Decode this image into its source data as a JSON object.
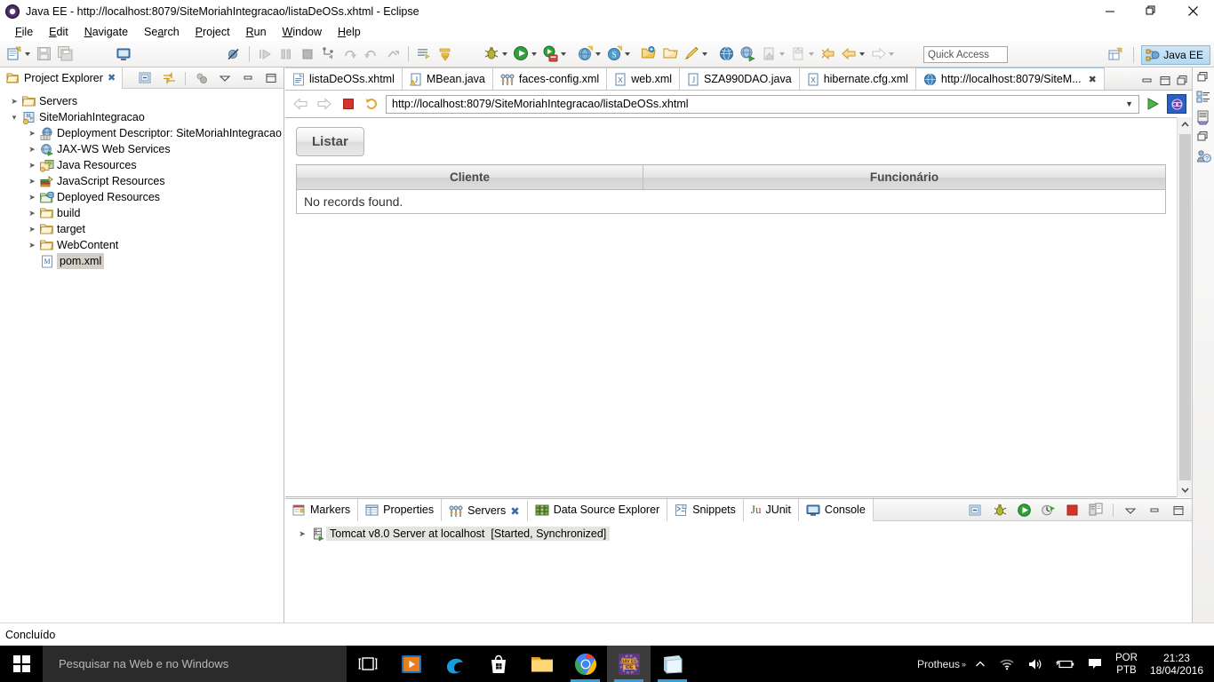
{
  "window": {
    "title": "Java EE - http://localhost:8079/SiteMoriahIntegracao/listaDeOSs.xhtml - Eclipse",
    "app_icon": "eclipse-icon",
    "minimize_label": "—",
    "maximize_label": "❐",
    "close_label": "✕"
  },
  "menubar": {
    "items": [
      {
        "label": "File",
        "mnemonic": "F"
      },
      {
        "label": "Edit",
        "mnemonic": "E"
      },
      {
        "label": "Navigate",
        "mnemonic": "N"
      },
      {
        "label": "Search",
        "mnemonic": "a"
      },
      {
        "label": "Project",
        "mnemonic": "P"
      },
      {
        "label": "Run",
        "mnemonic": "R"
      },
      {
        "label": "Window",
        "mnemonic": "W"
      },
      {
        "label": "Help",
        "mnemonic": "H"
      }
    ]
  },
  "toolbar": {
    "quick_access_placeholder": "Quick Access",
    "perspective_label": "Java EE",
    "items": [
      "new-wizard-icon",
      "save-icon",
      "save-all-icon",
      "console-view-icon",
      "toggle-breakpoint-icon",
      "resume-icon",
      "suspend-icon",
      "terminate-icon",
      "step-into-icon",
      "step-over-icon",
      "step-return-icon",
      "step-filters-icon",
      "run-last-tool-icon",
      "debug-icon",
      "run-icon",
      "run-server-icon",
      "new-java-ee-icon",
      "search-icon",
      "open-type-icon",
      "open-resource-icon",
      "annotation-icon",
      "web-browser-icon",
      "web-service-icon",
      "previous-edit-icon",
      "next-edit-icon",
      "back-icon",
      "forward-icon"
    ]
  },
  "project_explorer": {
    "tab_label": "Project Explorer",
    "tab_icon": "project-explorer-icon",
    "tools": [
      "collapse-all-icon",
      "link-with-editor-icon",
      "focus-on-active-task-icon",
      "view-menu-icon",
      "minimize-icon",
      "maximize-icon"
    ],
    "tree": [
      {
        "label": "Servers",
        "icon": "folder-icon",
        "depth": 0,
        "expandable": true,
        "expanded": false,
        "selected": false
      },
      {
        "label": "SiteMoriahIntegracao",
        "icon": "maven-project-icon",
        "depth": 0,
        "expandable": true,
        "expanded": true,
        "selected": false
      },
      {
        "label": "Deployment Descriptor: SiteMoriahIntegracao",
        "icon": "deployment-descriptor-icon",
        "depth": 1,
        "expandable": true,
        "expanded": false,
        "selected": false
      },
      {
        "label": "JAX-WS Web Services",
        "icon": "web-service-icon",
        "depth": 1,
        "expandable": true,
        "expanded": false,
        "selected": false
      },
      {
        "label": "Java Resources",
        "icon": "java-resources-icon",
        "depth": 1,
        "expandable": true,
        "expanded": false,
        "selected": false
      },
      {
        "label": "JavaScript Resources",
        "icon": "javascript-resources-icon",
        "depth": 1,
        "expandable": true,
        "expanded": false,
        "selected": false
      },
      {
        "label": "Deployed Resources",
        "icon": "deployed-resources-icon",
        "depth": 1,
        "expandable": true,
        "expanded": false,
        "selected": false
      },
      {
        "label": "build",
        "icon": "folder-icon",
        "depth": 1,
        "expandable": true,
        "expanded": false,
        "selected": false
      },
      {
        "label": "target",
        "icon": "folder-icon",
        "depth": 1,
        "expandable": true,
        "expanded": false,
        "selected": false
      },
      {
        "label": "WebContent",
        "icon": "folder-icon",
        "depth": 1,
        "expandable": true,
        "expanded": false,
        "selected": false
      },
      {
        "label": "pom.xml",
        "icon": "maven-pom-icon",
        "depth": 1,
        "expandable": false,
        "expanded": false,
        "selected": true
      }
    ]
  },
  "editor": {
    "tabs": [
      {
        "label": "listaDeOSs.xhtml",
        "icon": "xhtml-file-icon",
        "active": false,
        "closable": false
      },
      {
        "label": "MBean.java",
        "icon": "java-warning-file-icon",
        "active": false,
        "closable": false
      },
      {
        "label": "faces-config.xml",
        "icon": "faces-config-icon",
        "active": false,
        "closable": false
      },
      {
        "label": "web.xml",
        "icon": "xml-file-icon",
        "active": false,
        "closable": false
      },
      {
        "label": "SZA990DAO.java",
        "icon": "java-file-icon",
        "active": false,
        "closable": false
      },
      {
        "label": "hibernate.cfg.xml",
        "icon": "xml-file-icon",
        "active": false,
        "closable": false
      },
      {
        "label": "http://localhost:8079/SiteM...",
        "icon": "web-browser-icon",
        "active": true,
        "closable": true
      }
    ],
    "tab_tools": [
      "minimize-icon",
      "maximize-icon",
      "restore-icon"
    ],
    "browser": {
      "back_icon": "back-arrow-icon",
      "forward_icon": "forward-arrow-icon",
      "stop_icon": "stop-icon",
      "refresh_icon": "refresh-icon",
      "url": "http://localhost:8079/SiteMoriahIntegracao/listaDeOSs.xhtml",
      "dropdown_icon": "chevron-down-icon",
      "go_icon": "go-play-icon",
      "open_external_icon": "open-external-browser-icon",
      "scroll_up_icon": "▲",
      "scroll_down_icon": "▼"
    },
    "page": {
      "button_label": "Listar",
      "table": {
        "headers": [
          "Cliente",
          "Funcionário"
        ],
        "empty_message": "No records found."
      }
    }
  },
  "right_rail": {
    "items": [
      "restore-view-icon",
      "outline-view-icon",
      "properties-view-icon",
      "snippets-view-icon",
      "help-view-icon"
    ]
  },
  "bottom_panel": {
    "tabs": [
      {
        "label": "Markers",
        "icon": "markers-icon",
        "active": false,
        "closable": false
      },
      {
        "label": "Properties",
        "icon": "properties-icon",
        "active": false,
        "closable": false
      },
      {
        "label": "Servers",
        "icon": "servers-icon",
        "active": true,
        "closable": true
      },
      {
        "label": "Data Source Explorer",
        "icon": "data-source-explorer-icon",
        "active": false,
        "closable": false
      },
      {
        "label": "Snippets",
        "icon": "snippets-icon",
        "active": false,
        "closable": false
      },
      {
        "label": "JUnit",
        "icon": "junit-icon",
        "active": false,
        "closable": false
      },
      {
        "label": "Console",
        "icon": "console-icon",
        "active": false,
        "closable": false
      }
    ],
    "tools": [
      "collapse-all-icon",
      "debug-server-icon",
      "start-server-icon",
      "profile-server-icon",
      "stop-server-icon",
      "publish-icon",
      "view-menu-icon",
      "minimize-icon",
      "maximize-icon"
    ],
    "servers": [
      {
        "name": "Tomcat v8.0 Server at localhost",
        "state": "[Started, Synchronized]",
        "icon": "tomcat-server-icon"
      }
    ]
  },
  "statusbar": {
    "message": "Concluído"
  },
  "taskbar": {
    "start_icon": "windows-start-icon",
    "search_placeholder": "Pesquisar na Web e no Windows",
    "task_view_icon": "task-view-icon",
    "apps": [
      {
        "name": "media-player-icon",
        "running": false,
        "active": false
      },
      {
        "name": "microsoft-edge-icon",
        "running": false,
        "active": false
      },
      {
        "name": "microsoft-store-icon",
        "running": false,
        "active": false
      },
      {
        "name": "file-explorer-icon",
        "running": false,
        "active": false
      },
      {
        "name": "google-chrome-icon",
        "running": true,
        "active": false
      },
      {
        "name": "eclipse-ide-icon",
        "running": true,
        "active": true
      },
      {
        "name": "notepad-icon",
        "running": true,
        "active": false
      }
    ],
    "tray": {
      "app_label": "Protheus",
      "overflow_icon": "chevron-up-icon",
      "network_icon": "wifi-icon",
      "volume_icon": "speaker-icon",
      "power_icon": "battery-icon",
      "action_center_icon": "action-center-icon",
      "language_line1": "POR",
      "language_line2": "PTB",
      "time": "21:23",
      "date": "18/04/2016"
    }
  }
}
